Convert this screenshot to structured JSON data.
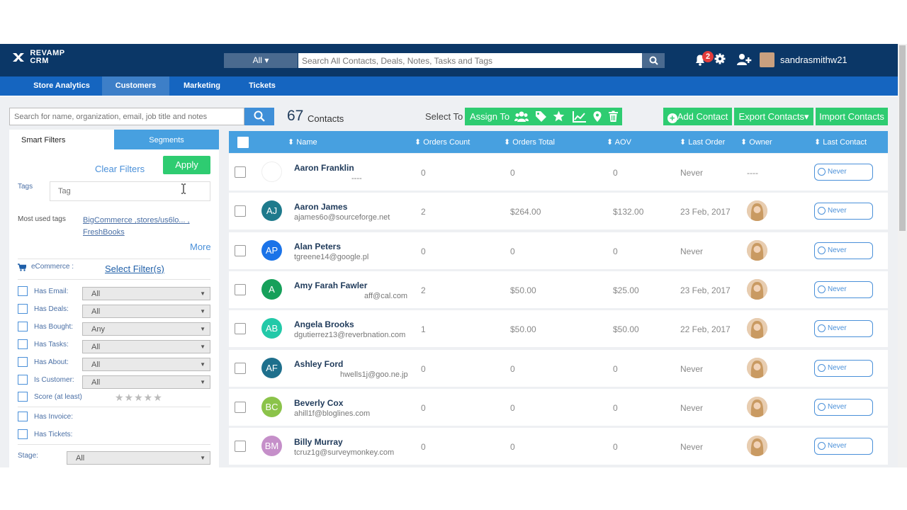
{
  "header": {
    "logo_line1": "REVAMP",
    "logo_line2": "CRM",
    "search_scope": "All",
    "search_placeholder": "Search All Contacts, Deals, Notes, Tasks and Tags",
    "notification_count": "2",
    "username": "sandrasmithw21"
  },
  "nav": {
    "items": [
      "Store Analytics",
      "Customers",
      "Marketing",
      "Tickets"
    ],
    "active": "Customers"
  },
  "toolbar": {
    "search_placeholder": "Search for name, organization, email, job title and notes",
    "count": "67",
    "count_label": "Contacts",
    "select_to": "Select To :",
    "assign_to": "Assign To",
    "add_contact": "Add Contact",
    "export": "Export Contacts",
    "import": "Import Contacts"
  },
  "sidebar": {
    "tab_smart": "Smart Filters",
    "tab_segments": "Segments",
    "clear": "Clear Filters",
    "apply": "Apply",
    "tags_label": "Tags",
    "tag_placeholder": "Tag",
    "most_used_label": "Most used tags",
    "most_used": [
      "BigCommerce ,",
      "stores/us6lo... ,",
      "FreshBooks"
    ],
    "more": "More",
    "ecommerce_label": "eCommerce :",
    "select_filters": "Select Filter(s)",
    "filters": [
      {
        "label": "Has Email:",
        "value": "All"
      },
      {
        "label": "Has Deals:",
        "value": "All"
      },
      {
        "label": "Has Bought:",
        "value": "Any"
      },
      {
        "label": "Has Tasks:",
        "value": "All"
      },
      {
        "label": "Has About:",
        "value": "All"
      },
      {
        "label": "Is Customer:",
        "value": "All"
      }
    ],
    "score_label": "Score (at least)",
    "stars": "★★★★★",
    "has_invoice": "Has Invoice:",
    "has_tickets": "Has Tickets:",
    "stage_label": "Stage:",
    "stage_value": "All"
  },
  "table": {
    "columns": [
      "Name",
      "Orders Count",
      "Orders Total",
      "AOV",
      "Last Order",
      "Owner",
      "Last Contact"
    ],
    "rows": [
      {
        "name": "Aaron Franklin",
        "email": "----",
        "initials": "",
        "color": "#ffffff",
        "count": "0",
        "total": "0",
        "aov": "0",
        "last_order": "Never",
        "owner": "----",
        "last_contact": "Never"
      },
      {
        "name": "Aaron James",
        "email": "ajames6o@sourceforge.net",
        "initials": "AJ",
        "color": "#1e7a8c",
        "count": "2",
        "total": "$264.00",
        "aov": "$132.00",
        "last_order": "23 Feb, 2017",
        "owner": "",
        "last_contact": "Never"
      },
      {
        "name": "Alan Peters",
        "email": "tgreene14@google.pl",
        "initials": "AP",
        "color": "#1a73e8",
        "count": "0",
        "total": "0",
        "aov": "0",
        "last_order": "Never",
        "owner": "",
        "last_contact": "Never"
      },
      {
        "name": "Amy Farah Fawler",
        "email": "aff@cal.com",
        "initials": "A",
        "color": "#16a05a",
        "count": "2",
        "total": "$50.00",
        "aov": "$25.00",
        "last_order": "23 Feb, 2017",
        "owner": "",
        "last_contact": "Never"
      },
      {
        "name": "Angela Brooks",
        "email": "dgutierrez13@reverbnation.com",
        "initials": "AB",
        "color": "#22c9a8",
        "count": "1",
        "total": "$50.00",
        "aov": "$50.00",
        "last_order": "22 Feb, 2017",
        "owner": "",
        "last_contact": "Never"
      },
      {
        "name": "Ashley Ford",
        "email": "hwells1j@goo.ne.jp",
        "initials": "AF",
        "color": "#1e6f8c",
        "count": "0",
        "total": "0",
        "aov": "0",
        "last_order": "Never",
        "owner": "",
        "last_contact": "Never"
      },
      {
        "name": "Beverly Cox",
        "email": "ahill1f@bloglines.com",
        "initials": "BC",
        "color": "#8bc34a",
        "count": "0",
        "total": "0",
        "aov": "0",
        "last_order": "Never",
        "owner": "",
        "last_contact": "Never"
      },
      {
        "name": "Billy Murray",
        "email": "tcruz1g@surveymonkey.com",
        "initials": "BM",
        "color": "#c58fc9",
        "count": "0",
        "total": "0",
        "aov": "0",
        "last_order": "Never",
        "owner": "",
        "last_contact": "Never"
      }
    ]
  }
}
